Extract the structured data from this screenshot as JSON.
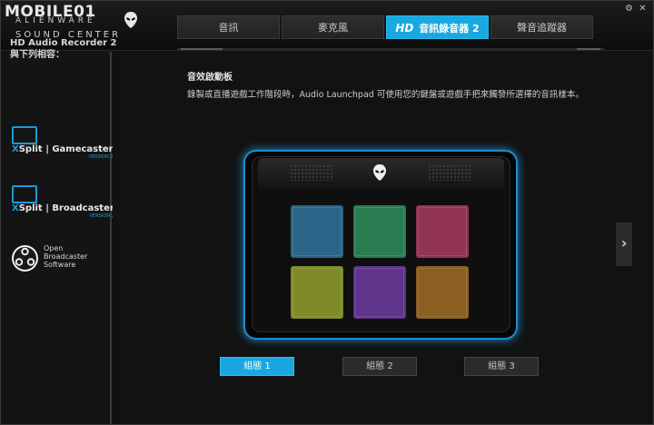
{
  "watermark": "MOBILE01",
  "brand": {
    "name": "ALIENWARE",
    "subtitle": "SOUND CENTER"
  },
  "window_controls": {
    "settings_icon": "gear-icon",
    "close_icon": "close-icon"
  },
  "tabs": [
    {
      "label": "音訊",
      "active": false
    },
    {
      "label": "麥克風",
      "active": false
    },
    {
      "prefix": "HD",
      "label": "音訊錄音器 2",
      "active": true
    },
    {
      "label": "聲音追蹤器",
      "active": false
    }
  ],
  "sidebar": {
    "title_line1": "HD Audio Recorder 2",
    "title_line2": "與下列相容：",
    "compatible": [
      {
        "x": "X",
        "name": "Split | Gamecaster",
        "version": "VERSION 2"
      },
      {
        "x": "X",
        "name": "Split | Broadcaster",
        "version": "VERSION 2"
      },
      {
        "line1": "Open",
        "line2": "Broadcaster",
        "line3": "Software"
      }
    ]
  },
  "main": {
    "section_title": "音效啟動板",
    "description": "錄製或直播遊戲工作階段時，Audio Launchpad 可使用您的鍵盤或遊戲手把來觸發所選擇的音訊樣本。"
  },
  "launchpad": {
    "pad_colors": [
      "#2f6f95",
      "#2e8a58",
      "#a23a5f",
      "#8d9a2c",
      "#6a3a9a",
      "#9a6a26"
    ]
  },
  "configs": [
    {
      "label": "組態 1",
      "active": true
    },
    {
      "label": "組態 2",
      "active": false
    },
    {
      "label": "組態 3",
      "active": false
    }
  ],
  "colors": {
    "accent": "#19a8e0"
  }
}
